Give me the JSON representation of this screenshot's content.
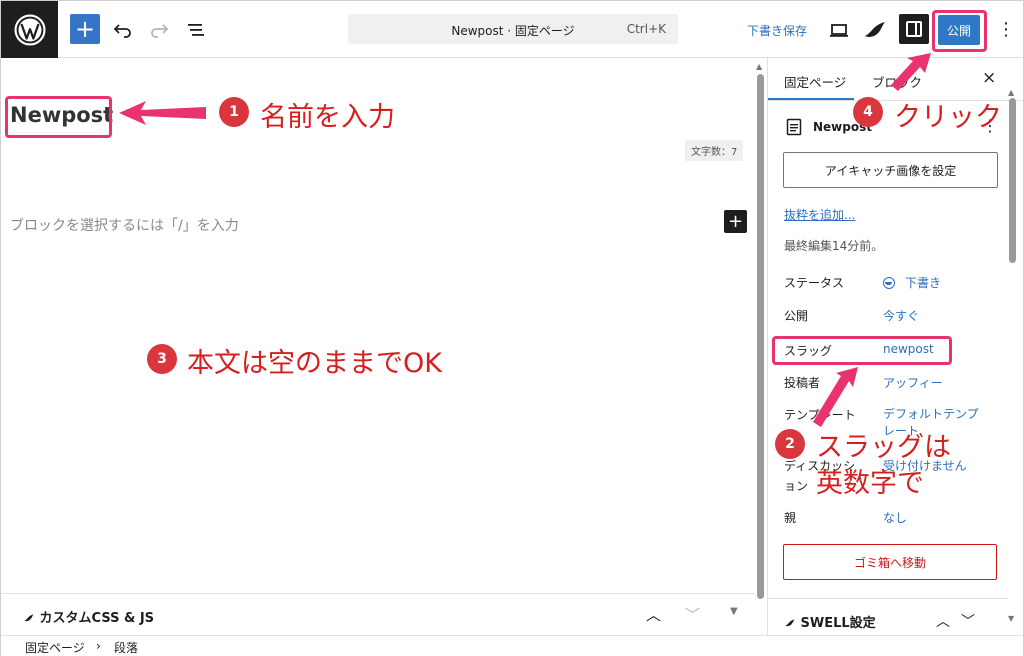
{
  "toolbar": {
    "add_block": "+",
    "command_bar_title": "Newpost · 固定ページ",
    "command_shortcut": "Ctrl+K",
    "save_draft": "下書き保存",
    "publish": "公開",
    "more": "⋮"
  },
  "editor": {
    "post_title": "Newpost",
    "word_count": "文字数：7",
    "block_placeholder": "ブロックを選択するには「/」を入力",
    "custom_css_label": "カスタムCSS & JS"
  },
  "breadcrumb": {
    "items": [
      "固定ページ",
      "段落"
    ],
    "separator": "›"
  },
  "sidebar": {
    "tabs": [
      "固定ページ",
      "ブロック"
    ],
    "active_tab": "固定ページ",
    "close": "×",
    "doc_title": "Newpost",
    "featured_image_button": "アイキャッチ画像を設定",
    "add_excerpt": "抜粋を追加...",
    "last_edited": "最終編集14分前。",
    "rows": [
      {
        "label": "ステータス",
        "value": "下書き"
      },
      {
        "label": "公開",
        "value": "今すぐ"
      },
      {
        "label": "スラッグ",
        "value": "newpost"
      },
      {
        "label": "投稿者",
        "value": "アッフィー"
      },
      {
        "label": "テンプレート",
        "value": "デフォルトテンプレート"
      },
      {
        "label": "ディスカッション",
        "value": "受け付けません"
      },
      {
        "label": "親",
        "value": "なし"
      }
    ],
    "trash_button": "ゴミ箱へ移動",
    "swell_settings": "SWELL設定"
  },
  "annotations": [
    {
      "number": "1",
      "text": "名前を入力"
    },
    {
      "number": "2",
      "text_line1": "スラッグは",
      "text_line2": "英数字で"
    },
    {
      "number": "3",
      "text": "本文は空のままでOK"
    },
    {
      "number": "4",
      "text": "クリック"
    }
  ],
  "colors": {
    "accent": "#2f78c4",
    "annotation_red": "#d6201f",
    "highlight_pink": "#e8336c",
    "dark": "#1e1e1e"
  }
}
